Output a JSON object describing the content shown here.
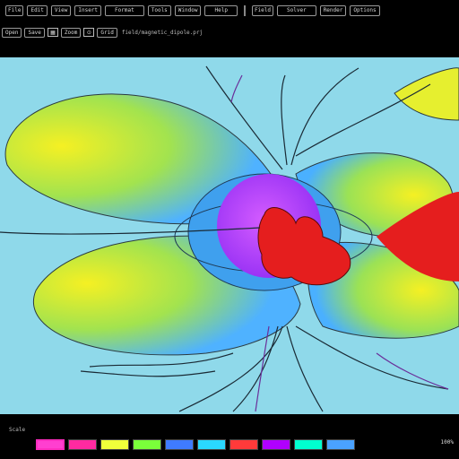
{
  "menubar": {
    "items": [
      {
        "label": "File",
        "icon": "file-icon"
      },
      {
        "label": "Edit"
      },
      {
        "label": "View"
      },
      {
        "label": "Insert"
      },
      {
        "label": "Format"
      },
      {
        "label": "Tools"
      },
      {
        "label": "Window"
      },
      {
        "label": "Help"
      },
      {
        "label": "Field"
      },
      {
        "label": "Solver"
      },
      {
        "label": "Render"
      },
      {
        "label": "Options"
      }
    ]
  },
  "toolbar": {
    "items": [
      {
        "label": "Open"
      },
      {
        "label": "Save"
      },
      {
        "label": "Zoom"
      },
      {
        "label": "Grid"
      }
    ],
    "path_text": "field/magnetic_dipole.prj"
  },
  "status": {
    "top_text": "Scale",
    "right_text": "100%"
  },
  "palette": {
    "swatches": [
      {
        "color": "#ff3fd0",
        "selected": true
      },
      {
        "color": "#ff2aa0",
        "selected": false
      },
      {
        "color": "#f0ff3a",
        "selected": false
      },
      {
        "color": "#7aff3a",
        "selected": false
      },
      {
        "color": "#3f7bff",
        "selected": false
      },
      {
        "color": "#2ad8ff",
        "selected": false
      },
      {
        "color": "#ff3a3a",
        "selected": false
      },
      {
        "color": "#b000ff",
        "selected": false
      },
      {
        "color": "#00ffcf",
        "selected": false
      },
      {
        "color": "#4aa2ff",
        "selected": false
      }
    ]
  },
  "colors": {
    "background": "#000000",
    "canvas": "#8fd9ea",
    "lobe_yellow": "#f2ef27",
    "lobe_green": "#a8e640",
    "core_purple": "#b83cf2",
    "core_red": "#e51e1e",
    "line_dark": "#1a2a35"
  }
}
